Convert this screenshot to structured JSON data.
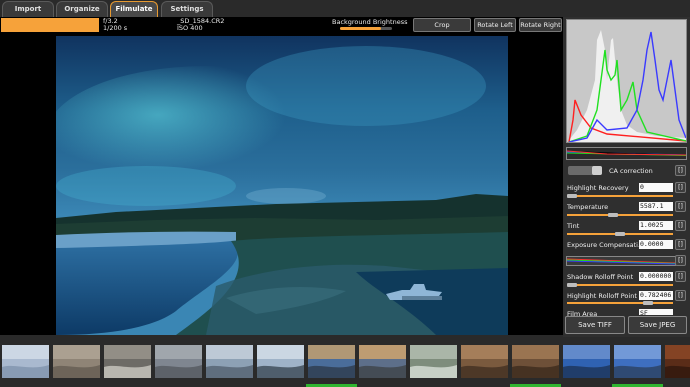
{
  "tabs": [
    {
      "label": "Import"
    },
    {
      "label": "Organize"
    },
    {
      "label": "Filmulate"
    },
    {
      "label": "Settings"
    }
  ],
  "info": {
    "aperture": "f/3.2",
    "shutter": "1/200 s",
    "filename": "_SD_1584.CR2",
    "iso": "ISO 400",
    "load_progress": 1.0
  },
  "background_brightness": {
    "label": "Background Brightness",
    "value": 0.78
  },
  "toolbar": {
    "crop": "Crop",
    "rotate_left": "Rotate Left",
    "rotate_right": "Rotate Right"
  },
  "controls": {
    "ca_correction": {
      "label": "CA correction",
      "enabled": true
    },
    "highlight_recovery": {
      "label": "Highlight Recovery",
      "value": "0"
    },
    "temperature": {
      "label": "Temperature",
      "value": "5587.1"
    },
    "tint": {
      "label": "Tint",
      "value": "1.0025"
    },
    "exposure": {
      "label": "Exposure Compensati...",
      "value": "0.0000"
    },
    "shadow_rolloff": {
      "label": "Shadow Rolloff Point",
      "value": "0.000000"
    },
    "highlight_rolloff": {
      "label": "Highlight Rolloff Point",
      "value": "0.782406"
    },
    "film_area": {
      "label": "Film Area",
      "value": "SF"
    },
    "reset_glyph": "[]"
  },
  "save": {
    "tiff": "Save TIFF",
    "jpeg": "Save JPEG"
  },
  "colors": {
    "accent": "#f6a23a",
    "tab_active_border": "#e89a30",
    "mark": "#2fb52f"
  },
  "filmstrip": {
    "thumbnails": [
      {
        "subject": "snowy-ground",
        "marked": false
      },
      {
        "subject": "beach-birds",
        "marked": false
      },
      {
        "subject": "gull-on-sand",
        "marked": false
      },
      {
        "subject": "driftwood",
        "marked": false
      },
      {
        "subject": "winter-branches",
        "marked": false
      },
      {
        "subject": "power-lines-sky",
        "marked": false
      },
      {
        "subject": "sunset-fence",
        "marked": true
      },
      {
        "subject": "marsh-sunset",
        "marked": false
      },
      {
        "subject": "pole-and-grass",
        "marked": false
      },
      {
        "subject": "wicker-texture",
        "marked": false
      },
      {
        "subject": "wicker-texture-2",
        "marked": true
      },
      {
        "subject": "blue-sky-trees",
        "marked": false
      },
      {
        "subject": "winter-trees-sky",
        "marked": true
      },
      {
        "subject": "rust-closeup",
        "marked": false
      }
    ]
  }
}
